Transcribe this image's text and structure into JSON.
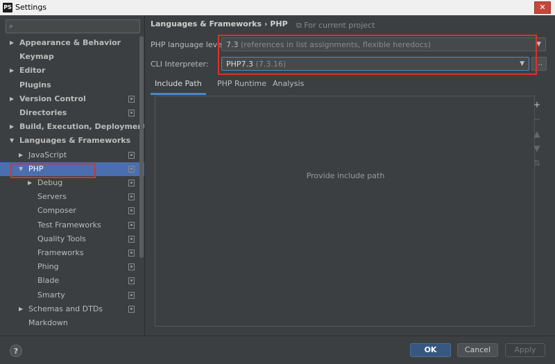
{
  "window": {
    "title": "Settings",
    "app_icon": "PS",
    "close_glyph": "✕"
  },
  "sidebar": {
    "search": {
      "placeholder": "",
      "icon": "search-icon"
    },
    "items": [
      {
        "label": "Appearance & Behavior",
        "level": 0,
        "expandable": true,
        "expanded": false,
        "bold": true,
        "project": false
      },
      {
        "label": "Keymap",
        "level": 0,
        "expandable": false,
        "bold": true,
        "project": false
      },
      {
        "label": "Editor",
        "level": 0,
        "expandable": true,
        "expanded": false,
        "bold": true,
        "project": false
      },
      {
        "label": "Plugins",
        "level": 0,
        "expandable": false,
        "bold": true,
        "project": false
      },
      {
        "label": "Version Control",
        "level": 0,
        "expandable": true,
        "expanded": false,
        "bold": true,
        "project": true
      },
      {
        "label": "Directories",
        "level": 0,
        "expandable": false,
        "bold": true,
        "project": true
      },
      {
        "label": "Build, Execution, Deployment",
        "level": 0,
        "expandable": true,
        "expanded": false,
        "bold": true,
        "project": false
      },
      {
        "label": "Languages & Frameworks",
        "level": 0,
        "expandable": true,
        "expanded": true,
        "bold": true,
        "project": false
      },
      {
        "label": "JavaScript",
        "level": 1,
        "expandable": true,
        "expanded": false,
        "bold": false,
        "project": true
      },
      {
        "label": "PHP",
        "level": 1,
        "expandable": true,
        "expanded": true,
        "bold": false,
        "project": true,
        "selected": true
      },
      {
        "label": "Debug",
        "level": 2,
        "expandable": true,
        "expanded": false,
        "bold": false,
        "project": true
      },
      {
        "label": "Servers",
        "level": 2,
        "expandable": false,
        "bold": false,
        "project": true
      },
      {
        "label": "Composer",
        "level": 2,
        "expandable": false,
        "bold": false,
        "project": true
      },
      {
        "label": "Test Frameworks",
        "level": 2,
        "expandable": false,
        "bold": false,
        "project": true
      },
      {
        "label": "Quality Tools",
        "level": 2,
        "expandable": false,
        "bold": false,
        "project": true
      },
      {
        "label": "Frameworks",
        "level": 2,
        "expandable": false,
        "bold": false,
        "project": true
      },
      {
        "label": "Phing",
        "level": 2,
        "expandable": false,
        "bold": false,
        "project": true
      },
      {
        "label": "Blade",
        "level": 2,
        "expandable": false,
        "bold": false,
        "project": true
      },
      {
        "label": "Smarty",
        "level": 2,
        "expandable": false,
        "bold": false,
        "project": true
      },
      {
        "label": "Schemas and DTDs",
        "level": 1,
        "expandable": true,
        "expanded": false,
        "bold": false,
        "project": true
      },
      {
        "label": "Markdown",
        "level": 1,
        "expandable": false,
        "bold": false,
        "project": false
      }
    ]
  },
  "main": {
    "breadcrumb": "Languages & Frameworks  ›  PHP",
    "for_project": "For current project",
    "language_level": {
      "label": "PHP language level:",
      "value": "7.3",
      "hint": "(references in list assignments, flexible heredocs)"
    },
    "cli": {
      "label": "CLI Interpreter:",
      "value": "PHP7.3",
      "hint": "(7.3.16)",
      "more": "..."
    },
    "tabs": [
      {
        "label": "Include Path",
        "active": true
      },
      {
        "label": "PHP Runtime",
        "active": false
      },
      {
        "label": "Analysis",
        "active": false
      }
    ],
    "empty_text": "Provide include path",
    "tools": [
      {
        "icon": "add-icon",
        "glyph": "+",
        "enabled": true
      },
      {
        "icon": "remove-icon",
        "glyph": "−",
        "enabled": false
      },
      {
        "icon": "move-up-icon",
        "glyph": "▲",
        "enabled": false
      },
      {
        "icon": "move-down-icon",
        "glyph": "▼",
        "enabled": false
      },
      {
        "icon": "sort-icon",
        "glyph": "⇅",
        "enabled": false
      }
    ]
  },
  "footer": {
    "help": "?",
    "ok": "OK",
    "cancel": "Cancel",
    "apply": "Apply"
  },
  "colors": {
    "accent": "#4b6eaf",
    "highlight_box": "#e0302c",
    "background": "#3c3f41"
  }
}
